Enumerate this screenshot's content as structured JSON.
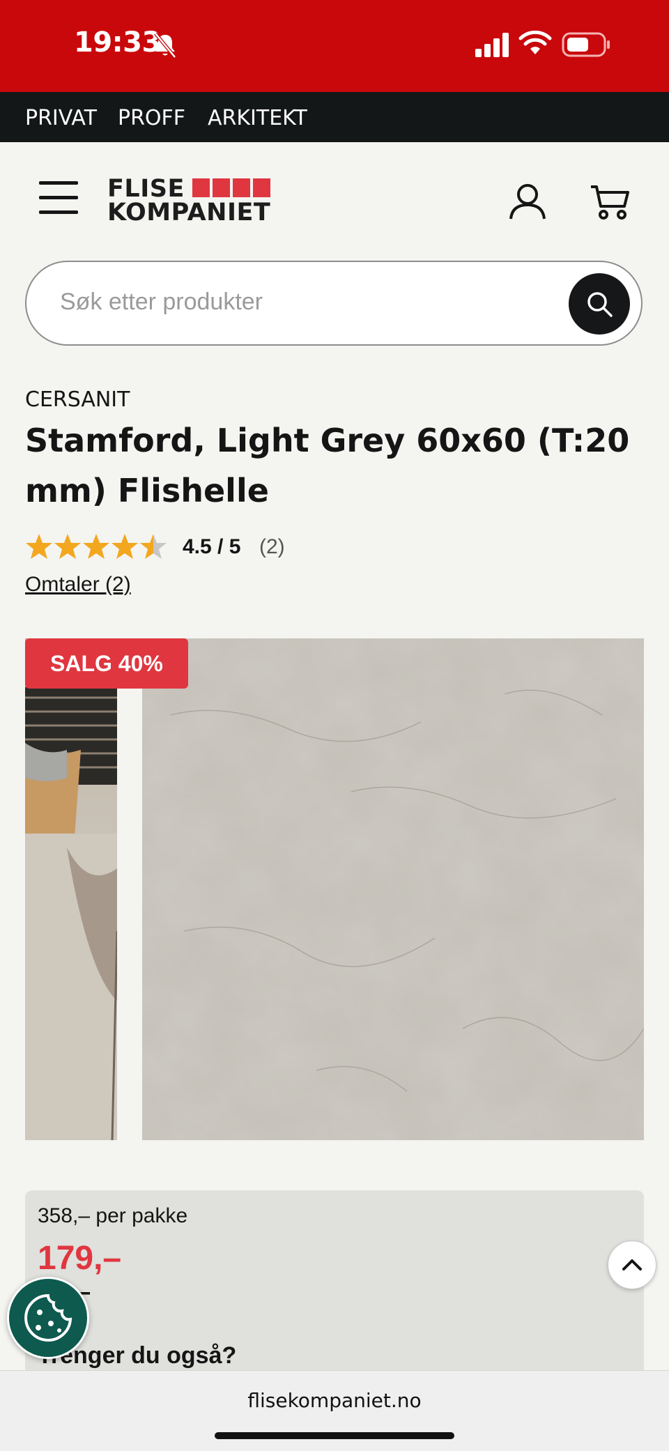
{
  "status_bar": {
    "time": "19:33"
  },
  "segments": [
    "PRIVAT",
    "PROFF",
    "ARKITEKT"
  ],
  "logo": {
    "line1": "FLISE",
    "line2": "KOMPANIET",
    "accent_color": "#e0363f"
  },
  "search": {
    "placeholder": "Søk etter produkter"
  },
  "product": {
    "brand": "CERSANIT",
    "title": "Stamford, Light Grey 60x60 (T:20 mm) Flishelle",
    "rating_value": 4.5,
    "rating_text": "4.5 / 5",
    "rating_count": "(2)",
    "reviews_link": "Omtaler (2)",
    "sale_badge": "SALG 40%"
  },
  "price": {
    "per_pack": "358,– per pakke",
    "current": "179,–",
    "original": "299,–"
  },
  "upsell_heading": "Trenger du også?",
  "browser": {
    "url": "flisekompaniet.no"
  },
  "colors": {
    "brand_red": "#c9080b",
    "sale_red": "#e0363f",
    "dark": "#141718"
  }
}
